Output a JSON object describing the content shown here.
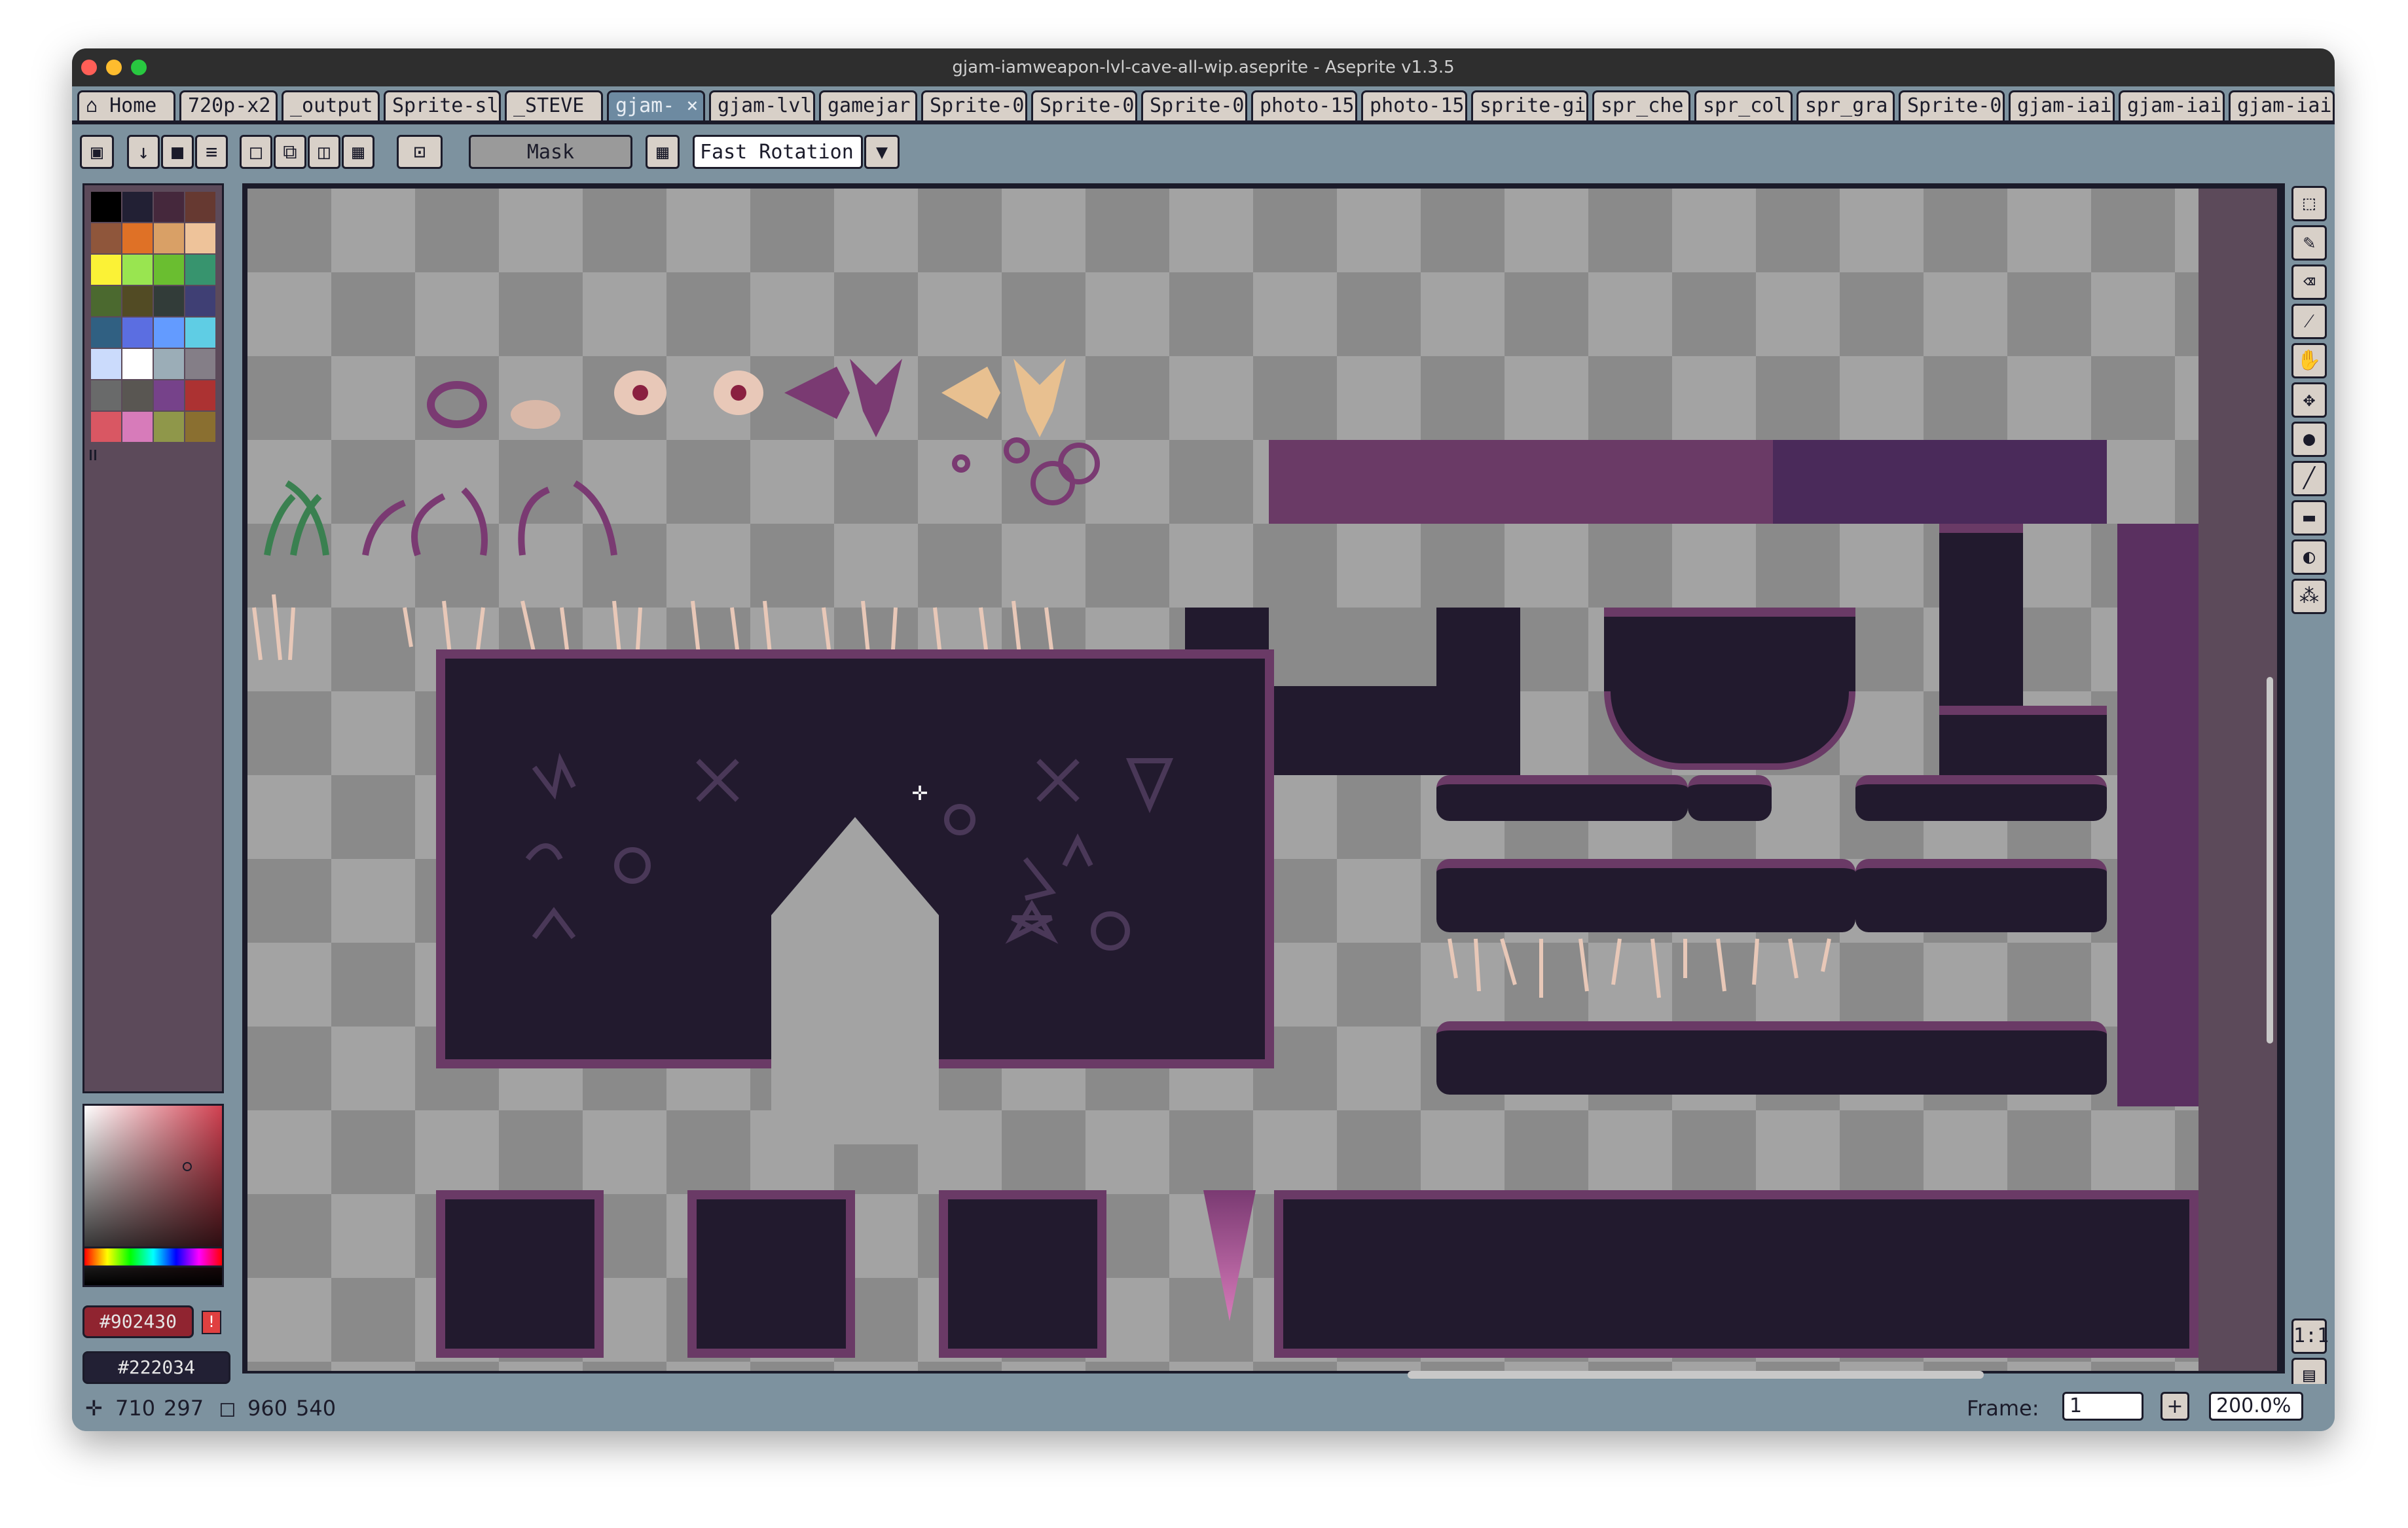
{
  "window": {
    "title": "gjam-iamweapon-lvl-cave-all-wip.aseprite - Aseprite v1.3.5"
  },
  "tabs": [
    {
      "label": "Home",
      "icon": "home-icon"
    },
    {
      "label": "720p-x2"
    },
    {
      "label": "_output"
    },
    {
      "label": "Sprite-sl"
    },
    {
      "label": "_STEVE"
    },
    {
      "label": "gjam-"
    },
    {
      "label": "gjam-lvl"
    },
    {
      "label": "gamejar"
    },
    {
      "label": "Sprite-0"
    },
    {
      "label": "Sprite-0"
    },
    {
      "label": "Sprite-0"
    },
    {
      "label": "photo-15"
    },
    {
      "label": "photo-15"
    },
    {
      "label": "sprite-gi"
    },
    {
      "label": "spr_che"
    },
    {
      "label": "spr_col"
    },
    {
      "label": "spr_gra"
    },
    {
      "label": "Sprite-0"
    },
    {
      "label": "gjam-iai"
    },
    {
      "label": "gjam-iai"
    },
    {
      "label": "gjam-iai"
    }
  ],
  "tab_close": "×",
  "toolbar": {
    "mask_label": "Mask",
    "rotation_algorithm": "Fast Rotation"
  },
  "palette": {
    "colors": [
      "#000000",
      "#222034",
      "#45283c",
      "#663931",
      "#8f563b",
      "#df7126",
      "#d9a066",
      "#eec39a",
      "#fbf236",
      "#99e550",
      "#6abe30",
      "#37946e",
      "#4b692f",
      "#524b24",
      "#323c39",
      "#3f3f74",
      "#306082",
      "#5b6ee1",
      "#639bff",
      "#5fcde4",
      "#cbdbfc",
      "#ffffff",
      "#9badb7",
      "#847e87",
      "#696a6a",
      "#595652",
      "#76428a",
      "#ac3232",
      "#d95763",
      "#d77bba",
      "#8f974a",
      "#8a6f30"
    ]
  },
  "colors": {
    "foreground": "#902430",
    "background": "#222034",
    "accent": "#6a3a66",
    "cave_dark": "#221a2e"
  },
  "status": {
    "cursor_x": "710",
    "cursor_y": "297",
    "size_w": "960",
    "size_h": "540",
    "frame_label": "Frame:",
    "frame_value": "1",
    "zoom": "200.0%"
  }
}
